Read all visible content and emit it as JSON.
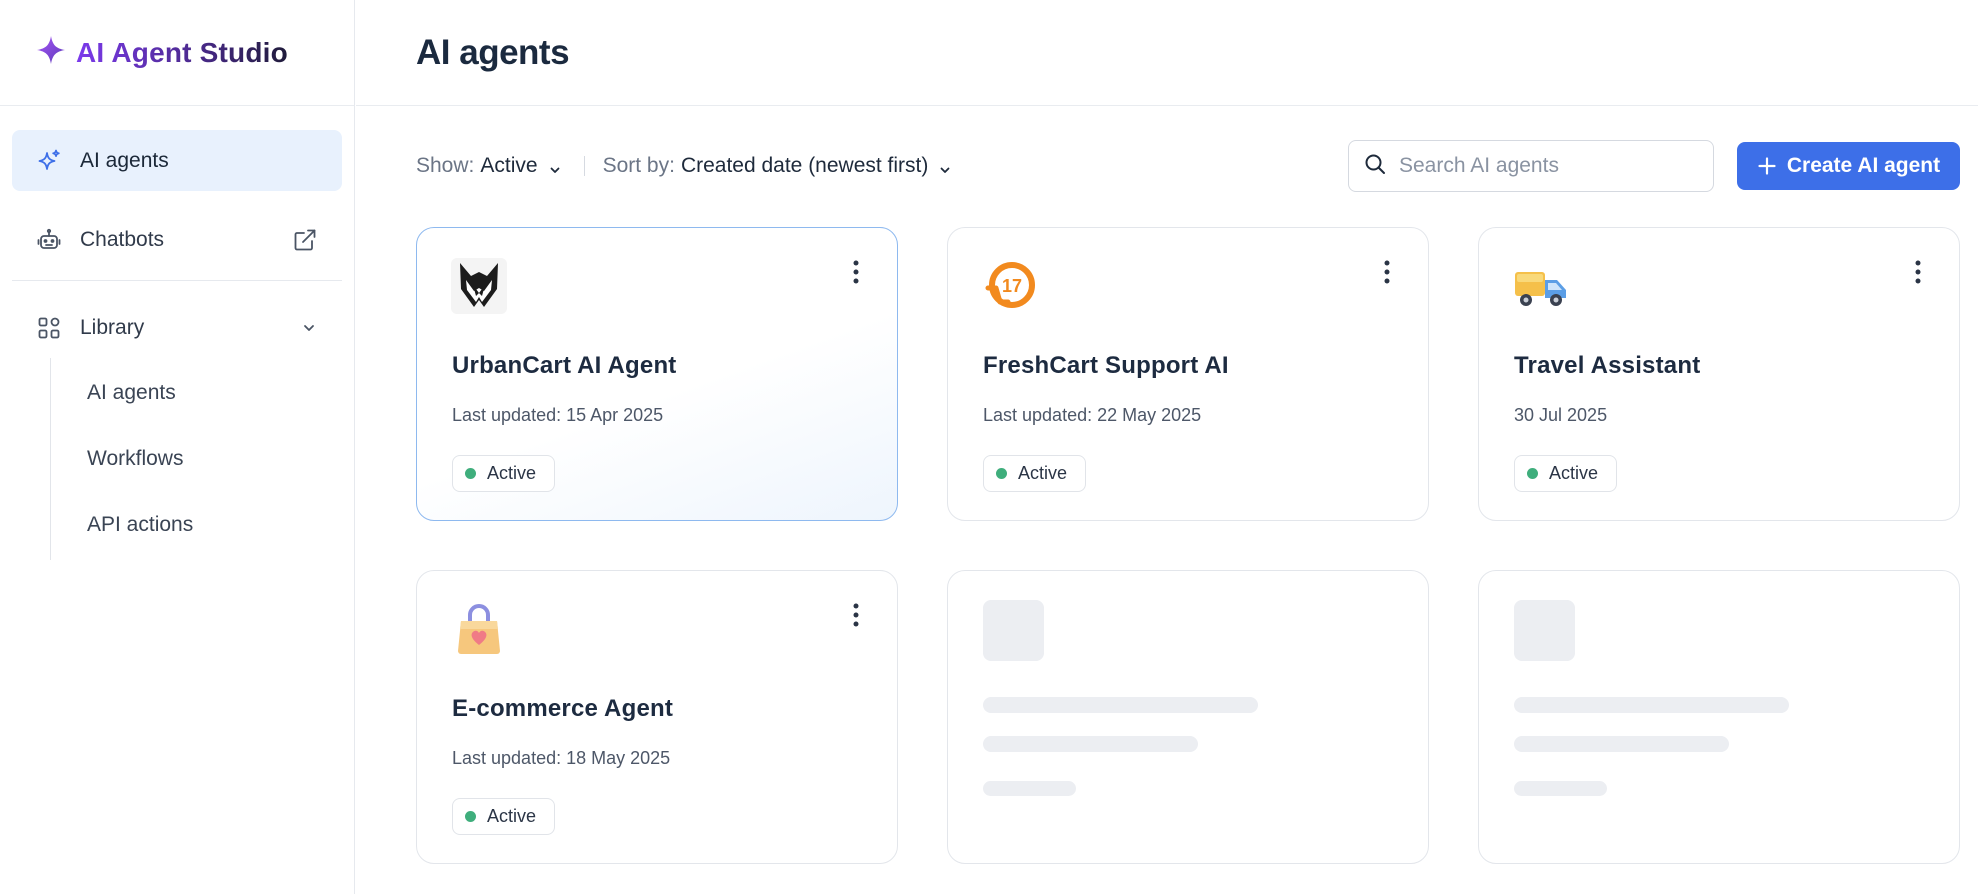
{
  "brand": {
    "name": "AI Agent Studio"
  },
  "sidebar": {
    "items": [
      {
        "label": "AI agents",
        "icon": "sparkle-icon",
        "active": true
      },
      {
        "label": "Chatbots",
        "icon": "chatbot-icon",
        "trailing_icon": "external-link-icon"
      },
      {
        "label": "Library",
        "icon": "library-icon",
        "trailing_icon": "chevron-down-icon",
        "expanded": true
      }
    ],
    "library_children": [
      "AI agents",
      "Workflows",
      "API actions"
    ]
  },
  "header": {
    "title": "AI agents"
  },
  "toolbar": {
    "show_label": "Show:",
    "show_value": "Active",
    "sort_label": "Sort by:",
    "sort_value": "Created date (newest first)",
    "search_placeholder": "Search AI agents",
    "search_value": "",
    "create_label": "Create AI agent"
  },
  "cards": [
    {
      "name": "UrbanCart AI Agent",
      "updated": "Last updated: 15 Apr 2025",
      "status": "Active",
      "logo": "fox-logo"
    },
    {
      "name": "FreshCart Support AI",
      "updated": "Last updated: 22 May 2025",
      "status": "Active",
      "logo": "cart-clock-logo"
    },
    {
      "name": "Travel Assistant",
      "updated": "30 Jul 2025",
      "status": "Active",
      "logo": "delivery-truck-logo"
    },
    {
      "name": "E-commerce Agent",
      "updated": "Last updated: 18 May 2025",
      "status": "Active",
      "logo": "shopping-bag-logo"
    }
  ],
  "colors": {
    "accent": "#3d6fe8",
    "active_nav_bg": "#e8f1fd",
    "status_active": "#3fae7c",
    "brand_gradient_start": "#7c3aed"
  }
}
